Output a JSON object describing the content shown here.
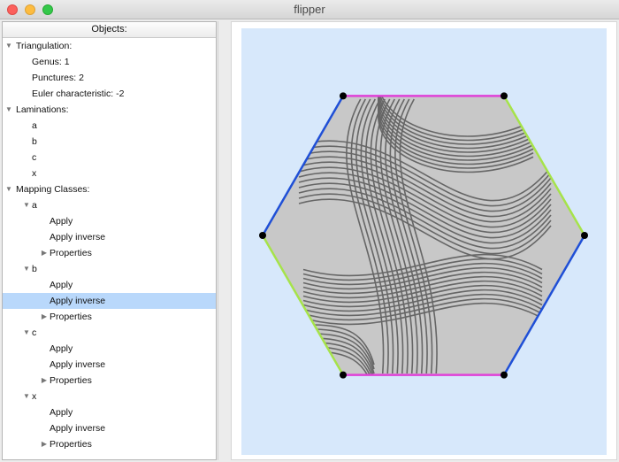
{
  "window": {
    "title": "flipper"
  },
  "panel": {
    "header": "Objects:",
    "tree": [
      {
        "label": "Triangulation:",
        "level": 0,
        "arrow": "down"
      },
      {
        "label": "Genus: 1",
        "level": 1
      },
      {
        "label": "Punctures: 2",
        "level": 1
      },
      {
        "label": "Euler characteristic: -2",
        "level": 1
      },
      {
        "label": "Laminations:",
        "level": 0,
        "arrow": "down"
      },
      {
        "label": "a",
        "level": 1
      },
      {
        "label": "b",
        "level": 1
      },
      {
        "label": "c",
        "level": 1
      },
      {
        "label": "x",
        "level": 1
      },
      {
        "label": "Mapping Classes:",
        "level": 0,
        "arrow": "down"
      },
      {
        "label": "a",
        "level": 1,
        "arrow": "down"
      },
      {
        "label": "Apply",
        "level": 2
      },
      {
        "label": "Apply inverse",
        "level": 2
      },
      {
        "label": "Properties",
        "level": 2,
        "arrow": "right"
      },
      {
        "label": "b",
        "level": 1,
        "arrow": "down"
      },
      {
        "label": "Apply",
        "level": 2
      },
      {
        "label": "Apply inverse",
        "level": 2,
        "selected": true
      },
      {
        "label": "Properties",
        "level": 2,
        "arrow": "right"
      },
      {
        "label": "c",
        "level": 1,
        "arrow": "down"
      },
      {
        "label": "Apply",
        "level": 2
      },
      {
        "label": "Apply inverse",
        "level": 2
      },
      {
        "label": "Properties",
        "level": 2,
        "arrow": "right"
      },
      {
        "label": "x",
        "level": 1,
        "arrow": "down"
      },
      {
        "label": "Apply",
        "level": 2
      },
      {
        "label": "Apply inverse",
        "level": 2
      },
      {
        "label": "Properties",
        "level": 2,
        "arrow": "right"
      }
    ]
  },
  "canvas": {
    "shape": "hexagon",
    "vertex_count": 6,
    "edge_colors": [
      "#e040d8",
      "#a6e34a",
      "#1f4fd6",
      "#e040d8",
      "#a6e34a",
      "#1f4fd6"
    ],
    "background": "#d7e8fb",
    "fill": "#c8c8c8",
    "curve_color": "#666666",
    "vertex_color": "#000000"
  }
}
